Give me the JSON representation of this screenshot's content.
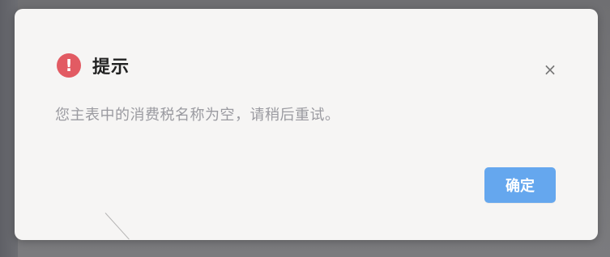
{
  "dialog": {
    "title": "提示",
    "message": "您主表中的消费税名称为空，请稍后重试。",
    "close_glyph": "×",
    "confirm_label": "确定",
    "warning_glyph": "!"
  },
  "colors": {
    "warning_icon_bg": "#e25b63",
    "confirm_button_bg": "#65a7ee",
    "dialog_bg": "#f6f5f4",
    "message_text": "#9a9aa0"
  },
  "icons": {
    "warning": "exclamation-circle-icon",
    "close": "close-icon"
  }
}
